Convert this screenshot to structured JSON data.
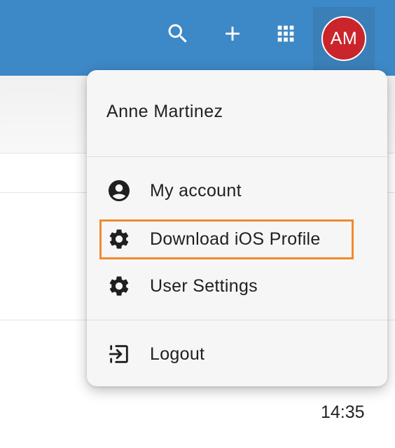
{
  "topbar": {
    "background": "#3d88c6",
    "icons": [
      "search-icon",
      "add-icon",
      "apps-grid-icon"
    ],
    "avatar_initials": "AM",
    "avatar_color": "#c9252b"
  },
  "menu": {
    "user_name": "Anne Martinez",
    "items": [
      {
        "label": "My account",
        "icon": "account-circle-icon"
      },
      {
        "label": "Download iOS Profile",
        "icon": "gear-icon",
        "highlighted": true
      },
      {
        "label": "User Settings",
        "icon": "gear-icon"
      },
      {
        "label": "Logout",
        "icon": "logout-icon"
      }
    ],
    "highlight_color": "#f08a2c"
  },
  "page": {
    "time": "14:35"
  }
}
